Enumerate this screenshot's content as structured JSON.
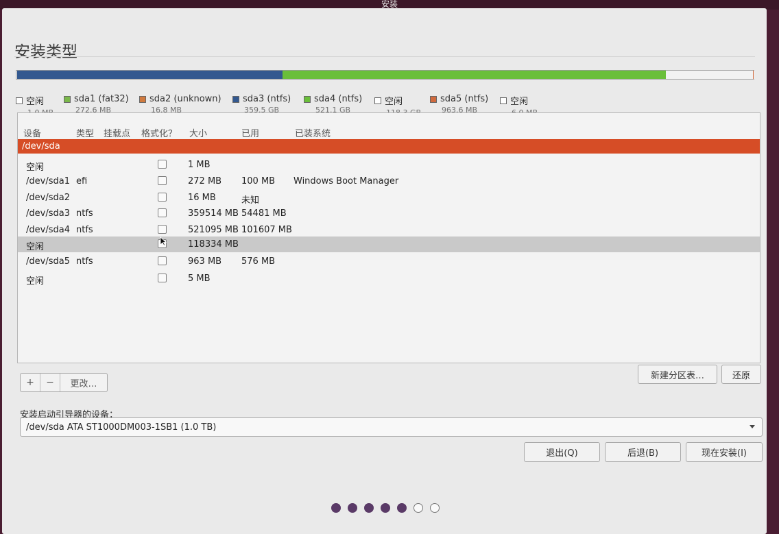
{
  "window_title": "安装",
  "page_title": "安装类型",
  "usage_bar": [
    {
      "name": "空闲",
      "color": "#f2f2f2",
      "fraction": 0.001
    },
    {
      "name": "sda1 (fat32)",
      "color": "#7ab84a",
      "fraction": 0.0003
    },
    {
      "name": "sda2 (unknown)",
      "color": "#d07a3e",
      "fraction": 0.0001
    },
    {
      "name": "sda3 (ntfs)",
      "color": "#33588f",
      "fraction": 0.36
    },
    {
      "name": "sda4 (ntfs)",
      "color": "#6abf3a",
      "fraction": 0.521
    },
    {
      "name": "空闲",
      "color": "#f2f2f2",
      "fraction": 0.1183
    },
    {
      "name": "sda5 (ntfs)",
      "color": "#d06a3e",
      "fraction": 0.001
    },
    {
      "name": "空闲",
      "color": "#f2f2f2",
      "fraction": 0.0001
    }
  ],
  "legend": [
    {
      "name": "空闲",
      "size": "1.0 MB",
      "color": "#ffffff"
    },
    {
      "name": "sda1 (fat32)",
      "size": "272.6 MB",
      "color": "#7ab84a"
    },
    {
      "name": "sda2 (unknown)",
      "size": "16.8 MB",
      "color": "#d07a3e"
    },
    {
      "name": "sda3 (ntfs)",
      "size": "359.5 GB",
      "color": "#33588f"
    },
    {
      "name": "sda4 (ntfs)",
      "size": "521.1 GB",
      "color": "#6abf3a"
    },
    {
      "name": "空闲",
      "size": "118.3 GB",
      "color": "#ffffff"
    },
    {
      "name": "sda5 (ntfs)",
      "size": "963.6 MB",
      "color": "#d06a3e"
    },
    {
      "name": "空闲",
      "size": "6.0 MB",
      "color": "#ffffff"
    }
  ],
  "table": {
    "headers": {
      "device": "设备",
      "type": "类型",
      "mount": "挂载点",
      "format": "格式化？",
      "size": "大小",
      "used": "已用",
      "os": "已装系统"
    },
    "disk": "/dev/sda",
    "rows": [
      {
        "device": "空闲",
        "type": "",
        "size": "1 MB",
        "used": "",
        "os": ""
      },
      {
        "device": "/dev/sda1",
        "type": "efi",
        "size": "272 MB",
        "used": "100 MB",
        "os": "Windows Boot Manager"
      },
      {
        "device": "/dev/sda2",
        "type": "",
        "size": "16 MB",
        "used": "未知",
        "os": ""
      },
      {
        "device": "/dev/sda3",
        "type": "ntfs",
        "size": "359514 MB",
        "used": "54481 MB",
        "os": ""
      },
      {
        "device": "/dev/sda4",
        "type": "ntfs",
        "size": "521095 MB",
        "used": "101607 MB",
        "os": ""
      },
      {
        "device": "空闲",
        "type": "",
        "size": "118334 MB",
        "used": "",
        "os": "",
        "selected": true
      },
      {
        "device": "/dev/sda5",
        "type": "ntfs",
        "size": "963 MB",
        "used": "576 MB",
        "os": ""
      },
      {
        "device": "空闲",
        "type": "",
        "size": "5 MB",
        "used": "",
        "os": ""
      }
    ]
  },
  "toolbar": {
    "add": "+",
    "remove": "−",
    "change": "更改…"
  },
  "new_table_button": "新建分区表…",
  "revert_button": "还原",
  "boot_loader_label": "安装启动引导器的设备：",
  "boot_loader_value": "/dev/sda    ATA ST1000DM003-1SB1 (1.0 TB)",
  "footer": {
    "quit": "退出(Q)",
    "back": "后退(B)",
    "install_now": "现在安装(I)"
  },
  "progress": {
    "total_steps": 7,
    "completed_steps": 5
  }
}
